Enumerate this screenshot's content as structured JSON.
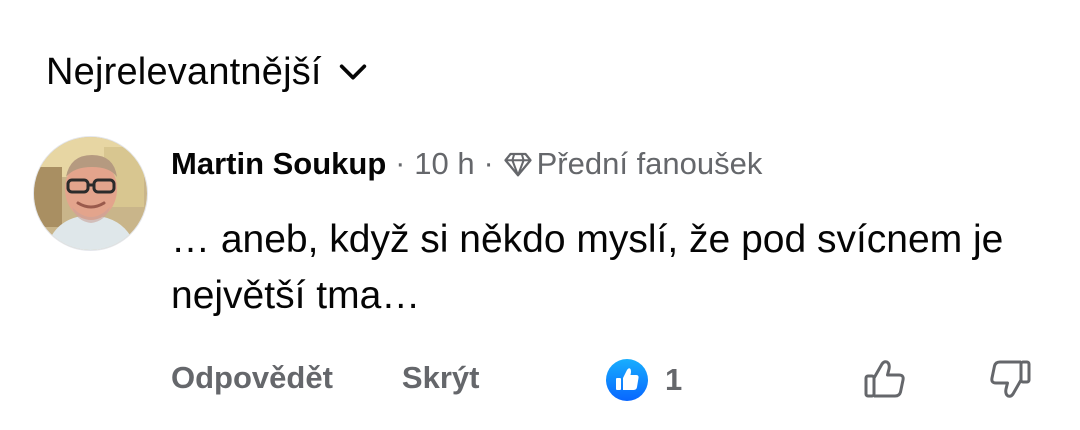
{
  "sort": {
    "label": "Nejrelevantnější",
    "icon": "chevron-down-icon"
  },
  "comment": {
    "author": "Martin Soukup",
    "separator": "·",
    "time": "10 h",
    "badge_icon": "diamond-icon",
    "badge_label": "Přední fanoušek",
    "text": "… aneb, když si někdo myslí, že pod svícnem je největší tma…",
    "actions": {
      "reply_label": "Odpovědět",
      "hide_label": "Skrýt"
    },
    "reactions": {
      "icon": "like-reaction-icon",
      "count": "1"
    },
    "vote_up_icon": "thumbs-up-icon",
    "vote_down_icon": "thumbs-down-icon"
  },
  "colors": {
    "text": "#050505",
    "muted": "#65676b",
    "like_blue": "#0866ff"
  }
}
